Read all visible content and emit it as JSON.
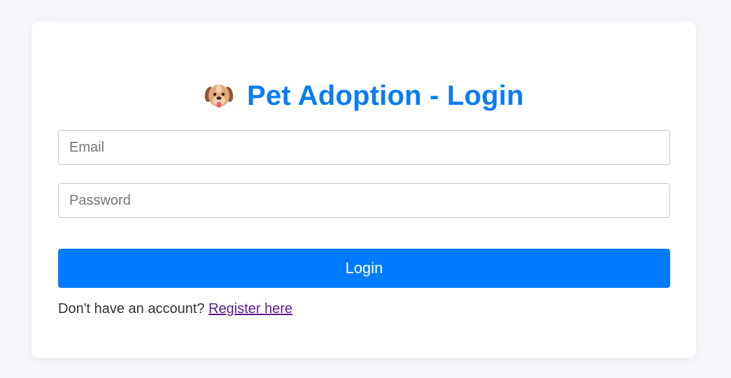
{
  "login_form": {
    "title_icon": "dog-face-icon",
    "title": "Pet Adoption - Login",
    "email_placeholder": "Email",
    "password_placeholder": "Password",
    "login_button": "Login",
    "register_prompt": "Don't have an account?",
    "register_link": "Register here"
  },
  "colors": {
    "page_background": "#f6f7fb",
    "title": "#0a7cf5",
    "primary_button": "#007bff",
    "visited_link": "#5a1a8c"
  }
}
